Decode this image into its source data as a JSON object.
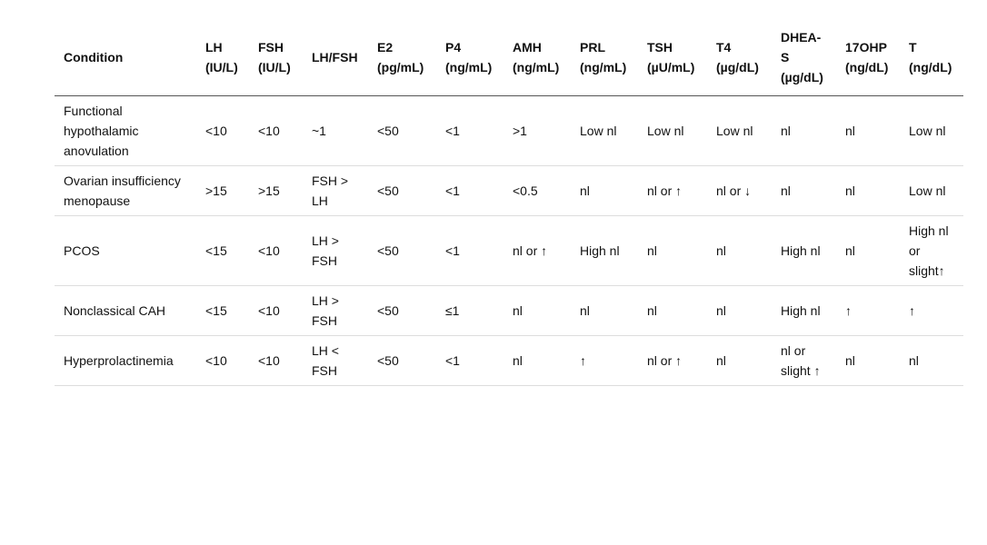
{
  "table": {
    "headers": [
      [
        "Condition"
      ],
      [
        "LH",
        "(IU/L)"
      ],
      [
        "FSH",
        "(IU/L)"
      ],
      [
        "LH/FSH"
      ],
      [
        "E2",
        "(pg/mL)"
      ],
      [
        "P4",
        "(ng/mL)"
      ],
      [
        "AMH",
        "(ng/mL)"
      ],
      [
        "PRL",
        "(ng/mL)"
      ],
      [
        "TSH",
        "(µU/mL)"
      ],
      [
        "T4",
        "(µg/dL)"
      ],
      [
        "DHEA-",
        "S",
        "(µg/dL)"
      ],
      [
        "17OHP",
        "(ng/dL)"
      ],
      [
        "T",
        "(ng/dL)"
      ]
    ],
    "rows": [
      [
        "Functional hypothalamic anovulation",
        "<10",
        "<10",
        "~1",
        "<50",
        "<1",
        ">1",
        "Low nl",
        "Low nl",
        "Low nl",
        "nl",
        "nl",
        "Low nl"
      ],
      [
        "Ovarian insufficiency menopause",
        ">15",
        ">15",
        "FSH > LH",
        "<50",
        "<1",
        "<0.5",
        "nl",
        "nl or ↑",
        "nl or ↓",
        "nl",
        "nl",
        "Low nl"
      ],
      [
        "PCOS",
        "<15",
        "<10",
        "LH > FSH",
        "<50",
        "<1",
        "nl or ↑",
        "High nl",
        "nl",
        "nl",
        "High nl",
        "nl",
        "High nl or slight↑"
      ],
      [
        "Nonclassical CAH",
        "<15",
        "<10",
        "LH > FSH",
        "<50",
        "≤1",
        "nl",
        "nl",
        "nl",
        "nl",
        "High nl",
        "↑",
        "↑"
      ],
      [
        "Hyperprolactinemia",
        "<10",
        "<10",
        "LH < FSH",
        "<50",
        "<1",
        "nl",
        "↑",
        "nl or ↑",
        "nl",
        "nl or slight ↑",
        "nl",
        "nl"
      ]
    ]
  }
}
